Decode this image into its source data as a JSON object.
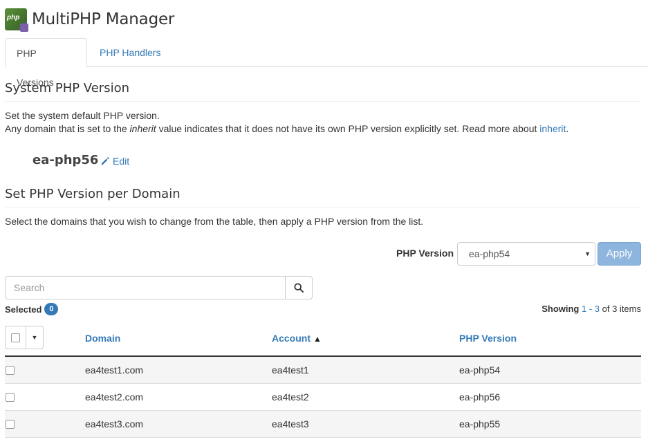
{
  "app": {
    "logo_text": "php",
    "title": "MultiPHP Manager"
  },
  "tabs": [
    {
      "label": "PHP Versions",
      "active": true
    },
    {
      "label": "PHP Handlers",
      "active": false
    }
  ],
  "system_section": {
    "title": "System PHP Version",
    "description_line1": "Set the system default PHP version.",
    "description_line2_before": "Any domain that is set to the ",
    "description_line2_italic": "inherit",
    "description_line2_after": " value indicates that it does not have its own PHP version explicitly set. Read more about ",
    "inherit_link": "inherit",
    "description_line2_end": ".",
    "current_version": "ea-php56",
    "edit_label": "Edit"
  },
  "domain_section": {
    "title": "Set PHP Version per Domain",
    "description": "Select the domains that you wish to change from the table, then apply a PHP version from the list.",
    "php_version_label": "PHP Version",
    "php_version_selected": "ea-php54",
    "apply_label": "Apply",
    "search_placeholder": "Search",
    "selected_label": "Selected",
    "selected_count": "0",
    "showing_label": "Showing",
    "showing_range": "1 - 3",
    "showing_suffix": "of 3 items"
  },
  "table": {
    "columns": {
      "domain": "Domain",
      "account": "Account",
      "php_version": "PHP Version"
    },
    "sort_indicator": "▲",
    "rows": [
      {
        "domain": "ea4test1.com",
        "account": "ea4test1",
        "php_version": "ea-php54"
      },
      {
        "domain": "ea4test2.com",
        "account": "ea4test2",
        "php_version": "ea-php56"
      },
      {
        "domain": "ea4test3.com",
        "account": "ea4test3",
        "php_version": "ea-php55"
      }
    ]
  },
  "colors": {
    "link": "#337ab7",
    "apply_disabled": "#8db5de",
    "badge": "#337ab7"
  }
}
